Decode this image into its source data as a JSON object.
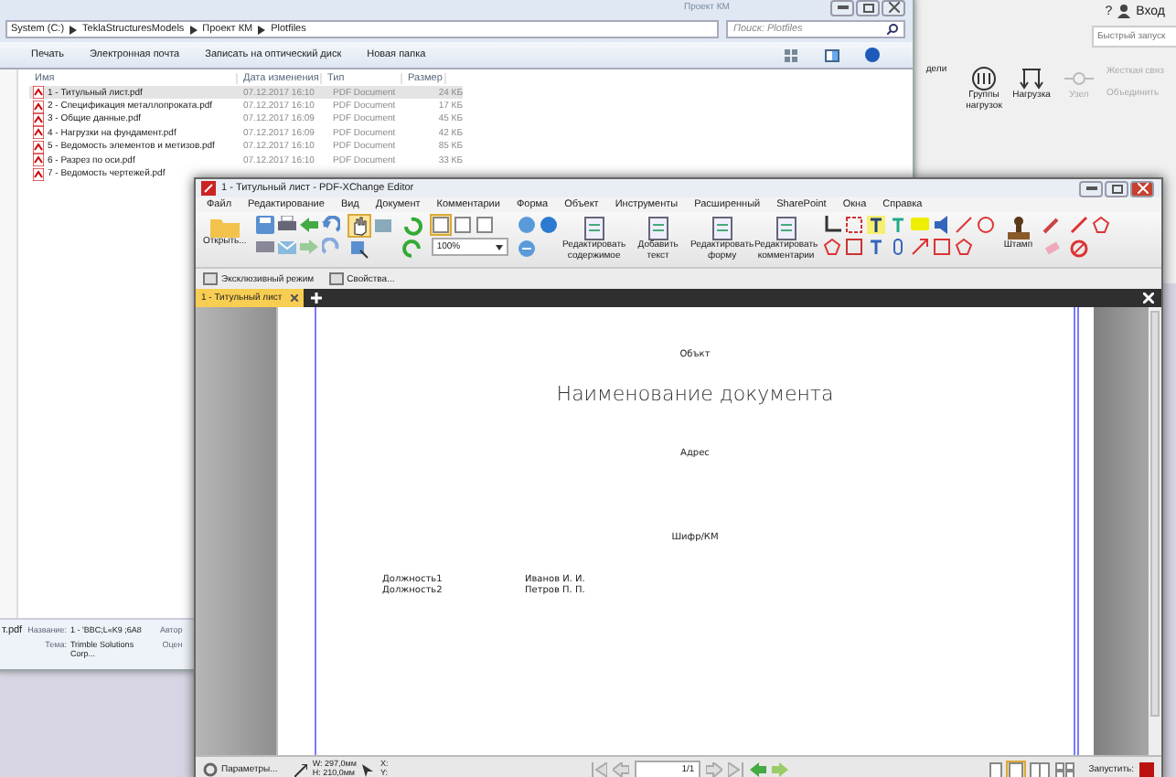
{
  "tekla": {
    "help": "?",
    "login": "Вход",
    "quick_launch": {
      "placeholder": "Быстрый запуск"
    },
    "ribbon": [
      {
        "label": "дели",
        "disabled": false
      },
      {
        "label": "Группы нагрузок",
        "disabled": false
      },
      {
        "label": "Нагрузка",
        "disabled": false
      },
      {
        "label": "Узел",
        "disabled": true
      }
    ],
    "side": [
      {
        "label": "Жесткая связ",
        "disabled": true
      },
      {
        "label": "Объединить",
        "disabled": true
      }
    ]
  },
  "explorer": {
    "title": "Проект КМ",
    "breadcrumb": [
      "System (C:)",
      "TeklaStructuresModels",
      "Проект КМ",
      "Plotfiles"
    ],
    "search": {
      "placeholder": "Поиск: Plotfiles"
    },
    "toolbar": [
      "Печать",
      "Электронная почта",
      "Записать на оптический диск",
      "Новая папка"
    ],
    "columns": [
      "Имя",
      "Дата изменения",
      "Тип",
      "Размер"
    ],
    "files": [
      {
        "name": "1 - Титульный лист.pdf",
        "date": "07.12.2017 16:10",
        "type": "PDF Document",
        "size": "24 КБ",
        "selected": true
      },
      {
        "name": "2 - Спецификация металлопроката.pdf",
        "date": "07.12.2017 16:10",
        "type": "PDF Document",
        "size": "17 КБ",
        "selected": false
      },
      {
        "name": "3 - Общие данные.pdf",
        "date": "07.12.2017 16:09",
        "type": "PDF Document",
        "size": "45 КБ",
        "selected": false
      },
      {
        "name": "4 - Нагрузки на фундамент.pdf",
        "date": "07.12.2017 16:09",
        "type": "PDF Document",
        "size": "42 КБ",
        "selected": false
      },
      {
        "name": "5 - Ведомость элементов и метизов.pdf",
        "date": "07.12.2017 16:10",
        "type": "PDF Document",
        "size": "85 КБ",
        "selected": false
      },
      {
        "name": "6 - Разрез по оси.pdf",
        "date": "07.12.2017 16:10",
        "type": "PDF Document",
        "size": "33 КБ",
        "selected": false
      },
      {
        "name": "7 - Ведомость чертежей.pdf",
        "selected": false
      }
    ],
    "details": {
      "file": "т.pdf",
      "fields": [
        {
          "label": "Название:",
          "value": "1 - 'BBC;L«K9 ;6A8",
          "extra": "Автор"
        },
        {
          "label": "Тема:",
          "value": "Trimble Solutions Corp...",
          "extra": "Оцен"
        }
      ]
    }
  },
  "pdf": {
    "title": "1 - Титульный лист - PDF-XChange Editor",
    "menu": [
      "Файл",
      "Редактирование",
      "Вид",
      "Документ",
      "Комментарии",
      "Форма",
      "Объект",
      "Инструменты",
      "Расширенный",
      "SharePoint",
      "Окна",
      "Справка"
    ],
    "toolbar": {
      "open": "Открыть...",
      "zoom": "100%",
      "buttons": [
        "Редактировать содержимое",
        "Добавить текст",
        "Редактировать форму",
        "Редактировать комментарии"
      ],
      "stamp": "Штамп"
    },
    "subtoolbar": [
      "Эксклюзивный режим",
      "Свойства..."
    ],
    "tabs": [
      {
        "label": "1 - Титульный лист",
        "selected": true
      }
    ],
    "page": {
      "object": "Объкт",
      "title": "Наименование документа",
      "address": "Адрес",
      "code": "Шифр/КМ",
      "signatures": [
        {
          "role": "Должность1",
          "name": "Иванов И. И."
        },
        {
          "role": "Должность2",
          "name": "Петров П. П."
        }
      ]
    },
    "status": {
      "options": "Параметры...",
      "width": "W: 297,0мм",
      "height": "H: 210,0мм",
      "x": "X:",
      "y": "Y:",
      "page": "1/1",
      "launch": "Запустить:"
    }
  }
}
